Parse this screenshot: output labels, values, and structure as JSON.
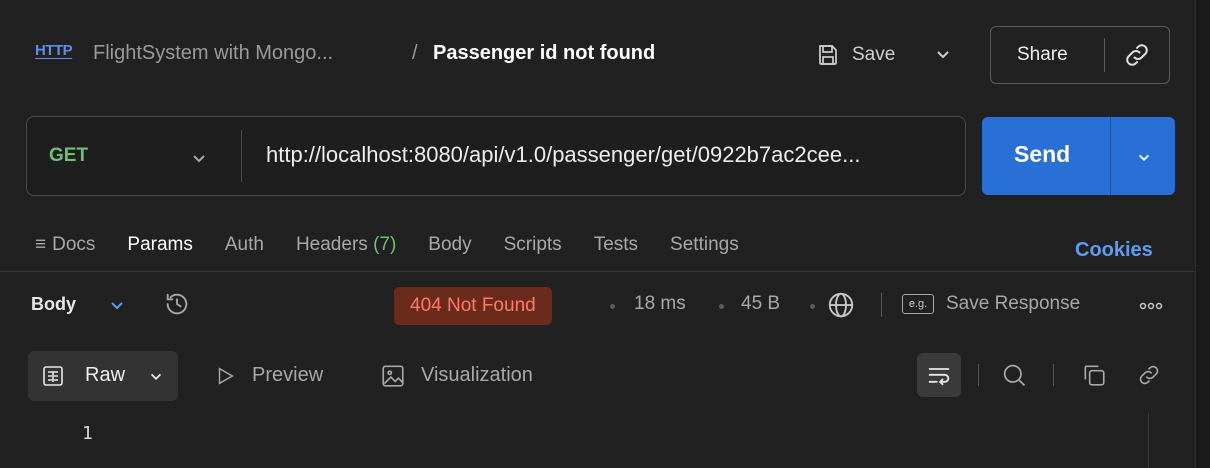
{
  "header": {
    "protocol_label": "HTTP",
    "collection_name": "FlightSystem with Mongo...",
    "separator": "/",
    "request_title": "Passenger id not found",
    "save_label": "Save",
    "share_label": "Share"
  },
  "request": {
    "method": "GET",
    "url": "http://localhost:8080/api/v1.0/passenger/get/0922b7ac2cee...",
    "send_label": "Send"
  },
  "tabs": {
    "docs": "Docs",
    "params": "Params",
    "auth": "Auth",
    "headers": "Headers",
    "headers_count": "(7)",
    "body": "Body",
    "scripts": "Scripts",
    "tests": "Tests",
    "settings": "Settings",
    "cookies": "Cookies"
  },
  "response": {
    "body_label": "Body",
    "status": "404 Not Found",
    "time": "18 ms",
    "size": "45 B",
    "eg_label": "e.g.",
    "save_response_label": "Save Response"
  },
  "format_toolbar": {
    "raw_label": "Raw",
    "preview_label": "Preview",
    "visualization_label": "Visualization"
  },
  "editor": {
    "line_numbers": [
      "1"
    ]
  },
  "colors": {
    "background": "#212121",
    "accent_blue": "#2870d6",
    "method_green": "#6cc070",
    "status_error_bg": "#6a2a1c",
    "status_error_text": "#ff7b63",
    "link_blue": "#5e9cf0"
  }
}
